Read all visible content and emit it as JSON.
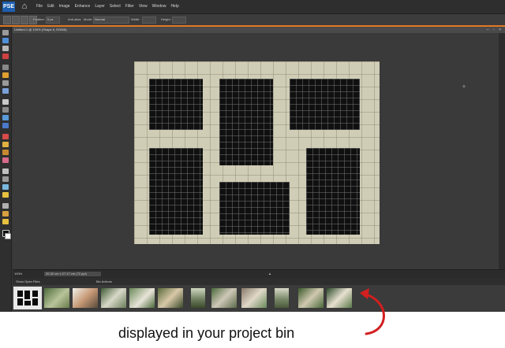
{
  "menubar": {
    "logo": "PSE",
    "items": [
      "File",
      "Edit",
      "Image",
      "Enhance",
      "Layer",
      "Select",
      "Filter",
      "View",
      "Window",
      "Help"
    ]
  },
  "options": {
    "feather_label": "Feather:",
    "feather_value": "0 px",
    "antialias_label": "Anti-alias",
    "mode_label": "Mode:",
    "mode_value": "Normal",
    "width_label": "Width:",
    "height_label": "Height:"
  },
  "document": {
    "tab_title": "Untitled-1 @ 100% (Shape 6, RGB/8)",
    "zoom": "100%",
    "doc_info": "20.32 cm x 27.17 cm (72 ppi)"
  },
  "bin": {
    "show_open_files": "Show Open Files",
    "bin_actions": "Bin Actions",
    "thumbnail_count": 12
  },
  "caption": "displayed in your project bin",
  "colors": {
    "accent_orange": "#e07820",
    "arrow_red": "#d21f1f",
    "paper": "#cfcdb6"
  }
}
